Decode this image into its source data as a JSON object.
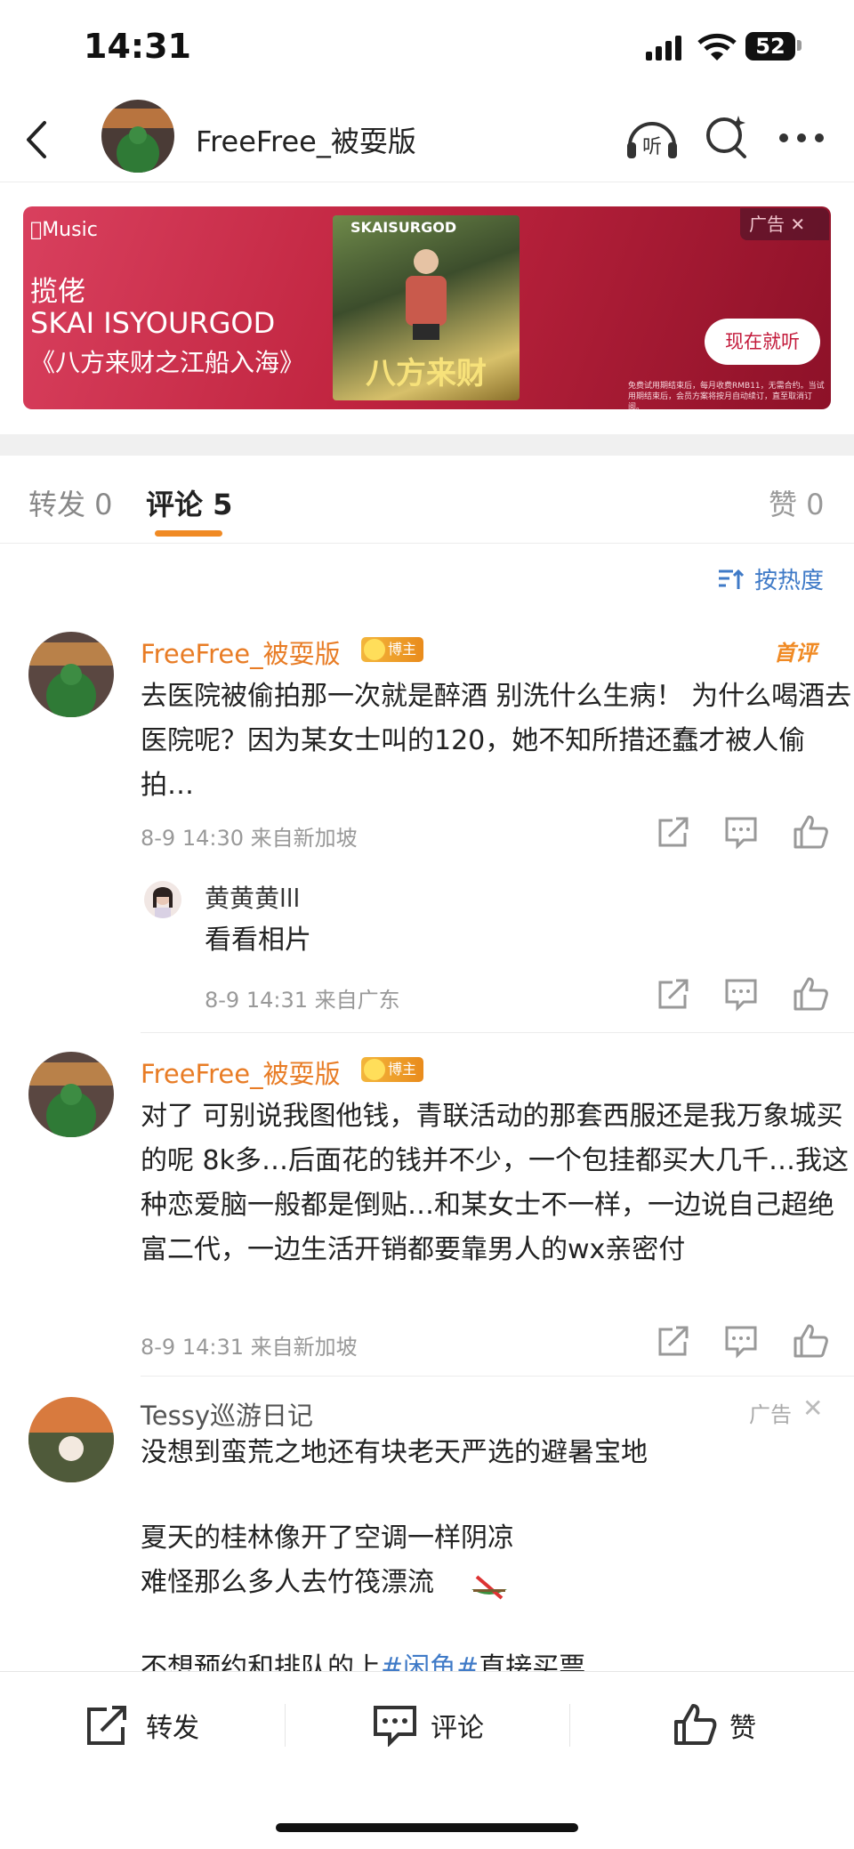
{
  "status_bar": {
    "time": "14:31",
    "battery": "52"
  },
  "nav": {
    "title": "FreeFree_被耍版",
    "listen_label": "听"
  },
  "ad_banner": {
    "brand": "Music",
    "line1": "揽佬",
    "line2": "SKAI ISYOURGOD",
    "line3": "《八方来财之江船入海》",
    "cover_top": "SKAISURGOD",
    "cover_title": "八方来财",
    "badge": "广告",
    "cta": "现在就听",
    "fine_print": "免费试用期结束后，每月收费RMB11，无需合约。当试用期结束后，会员方案将按月自动续订，直至取消订阅。"
  },
  "tabs": {
    "repost": "转发 0",
    "comment": "评论 5",
    "like": "赞 0"
  },
  "sort_label": "按热度",
  "comments": [
    {
      "user": "FreeFree_被耍版",
      "badge": "博主",
      "first_label": "首评",
      "text": "去医院被偷拍那一次就是醉酒 别洗什么生病！ 为什么喝酒去医院呢？因为某女士叫的120，她不知所措还蠢才被人偷拍…",
      "meta": "8-9 14:30  来自新加坡",
      "reply": {
        "user": "黄黄黄lll",
        "text": "看看相片",
        "meta": "8-9 14:31  来自广东"
      }
    },
    {
      "user": "FreeFree_被耍版",
      "badge": "博主",
      "text": "对了 可别说我图他钱，青联活动的那套西服还是我万象城买的呢 8k多…后面花的钱并不少，一个包挂都买大几千…我这种恋爱脑一般都是倒贴…和某女士不一样，一边说自己超绝富二代，一边生活开销都要靠男人的wx亲密付",
      "meta": "8-9 14:31  来自新加坡"
    }
  ],
  "ad_comment": {
    "user": "Tessy巡游日记",
    "ad_label": "广告",
    "line1": "没想到蛮荒之地还有块老天严选的避暑宝地",
    "line2": "夏天的桂林像开了空调一样阴凉",
    "line3": "难怪那么多人去竹筏漂流",
    "line4_pre": "不想预约和排队的上",
    "line4_tag": "#闲鱼#",
    "line4_post": "直接买票"
  },
  "bottom_bar": {
    "repost": "转发",
    "comment": "评论",
    "like": "赞"
  },
  "colors": {
    "accent_orange": "#f08a24",
    "link_blue": "#3f7ac7",
    "banner_red": "#c0243f"
  }
}
